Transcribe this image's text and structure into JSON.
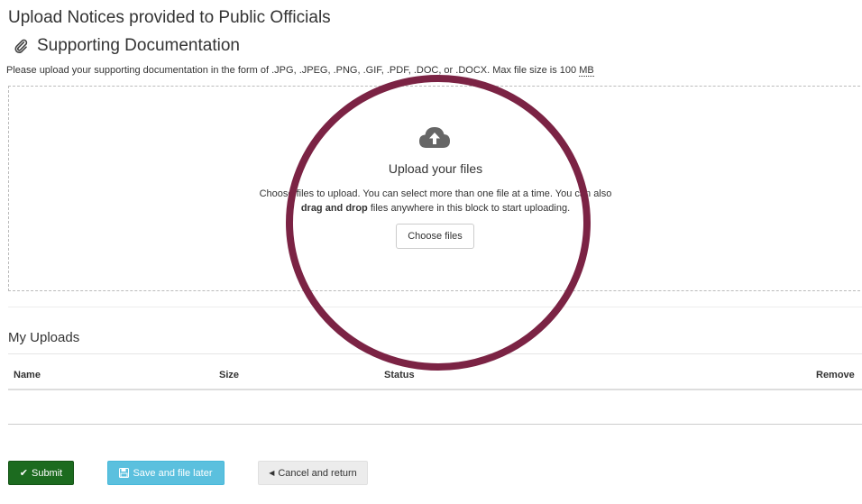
{
  "page": {
    "title": "Upload Notices provided to Public Officials",
    "section_title": "Supporting Documentation",
    "help_text_prefix": "Please upload your supporting documentation in the form of .JPG, .JPEG, .PNG, .GIF, .PDF, .DOC, or .DOCX. Max file size is 100 ",
    "help_text_unit": "MB"
  },
  "dropzone": {
    "title": "Upload your files",
    "description_line1": "Choose files to upload. You can select more than one file at a time. You can also",
    "description_line2_bold": "drag and drop",
    "description_line2_rest": " files anywhere in this block to start uploading.",
    "choose_button": "Choose files",
    "icon": "cloud-upload-icon"
  },
  "uploads": {
    "heading": "My Uploads",
    "columns": [
      "Name",
      "Size",
      "Status",
      "Remove"
    ],
    "rows": []
  },
  "actions": {
    "submit": "Submit",
    "save": "Save and file later",
    "cancel": "Cancel and return"
  },
  "colors": {
    "submit_bg": "#1c6b1f",
    "save_bg": "#5bc0de",
    "cancel_bg": "#ececec",
    "highlight_circle": "#7b2344"
  }
}
